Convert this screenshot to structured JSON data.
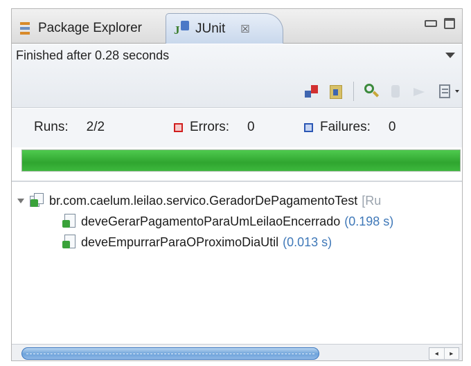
{
  "tabs": [
    {
      "label": "Package Explorer",
      "icon": "package-explorer-icon"
    },
    {
      "label": "JUnit",
      "icon": "junit-icon",
      "active": true,
      "close_glyph": "☒"
    }
  ],
  "status": {
    "text": "Finished after 0.28 seconds"
  },
  "counters": {
    "runs_label": "Runs:",
    "runs_value": "2/2",
    "errors_label": "Errors:",
    "errors_value": "0",
    "failures_label": "Failures:",
    "failures_value": "0"
  },
  "progress": {
    "fraction": 1.0,
    "color": "#36b336"
  },
  "tree": {
    "suite": {
      "label": "br.com.caelum.leilao.servico.GeradorDePagamentoTest",
      "trailing": "[Ru"
    },
    "tests": [
      {
        "label": "deveGerarPagamentoParaUmLeilaoEncerrado",
        "time": "(0.198 s)"
      },
      {
        "label": "deveEmpurrarParaOProximoDiaUtil",
        "time": "(0.013 s)"
      }
    ]
  },
  "scrollbar": {
    "left_glyph": "◂",
    "right_glyph": "▸"
  }
}
